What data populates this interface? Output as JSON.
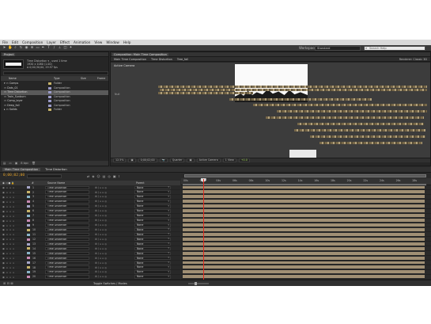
{
  "menu": [
    "File",
    "Edit",
    "Composition",
    "Layer",
    "Effect",
    "Animation",
    "View",
    "Window",
    "Help"
  ],
  "toolbar": {
    "workspace_label": "Workspace:",
    "workspace_value": "Standard",
    "search_placeholder": "Search Help"
  },
  "project": {
    "tab": "Project",
    "info": [
      "Time Distortion ▾ , used 1 time",
      "1920 x 1080 (1.00)",
      "Δ 0;00;30;00, 29.97 fps"
    ],
    "columns": {
      "name": "Name",
      "type": "Type",
      "size": "Size",
      "fr": "Frame"
    },
    "items": [
      {
        "name": "▾ ▭ Comps",
        "type": "Folder",
        "color": "#c8b46a",
        "selected": false
      },
      {
        "name": "  ▭ Dots_01",
        "type": "Composition",
        "color": "#9a9ac8",
        "selected": false
      },
      {
        "name": "  ▭ Time Distortion",
        "type": "Composition",
        "color": "#9a9ac8",
        "selected": true
      },
      {
        "name": "  ▭ Train_Sunburn",
        "type": "Composition",
        "color": "#9a9ac8",
        "selected": false
      },
      {
        "name": "  ▭ Comp_layer",
        "type": "Composition",
        "color": "#9a9ac8",
        "selected": false
      },
      {
        "name": "  ▭ Deep_fall",
        "type": "Composition",
        "color": "#9a9ac8",
        "selected": false
      },
      {
        "name": "▸ ▭ Solids",
        "type": "Folder",
        "color": "#c8b46a",
        "selected": false
      }
    ],
    "bpc": "8 bpc"
  },
  "comp": {
    "tab": "Composition: Main Time Composition",
    "crumbs": [
      "Main Time Composition",
      "Time Distortion",
      "Tree_fall"
    ],
    "renderer": "Renderer: Classic 3D",
    "camera": "Active Camera",
    "null_label": "Null",
    "viewer_bar": [
      "12.5%",
      "▣",
      "0;00;02;00",
      "📷",
      "Quarter",
      "▣",
      "Active Camera",
      "1 View",
      "+0.0"
    ]
  },
  "timeline": {
    "tabs": [
      "Main Time Composition",
      "Time Distortion"
    ],
    "timecode": "0;00;02;00",
    "columns": {
      "source": "Source Name",
      "parent": "Parent"
    },
    "layers": [
      {
        "num": "1",
        "name": "Time Distortion",
        "parent": "None"
      },
      {
        "num": "2",
        "name": "Time Distortion",
        "parent": "None"
      },
      {
        "num": "3",
        "name": "Time Distortion",
        "parent": "None"
      },
      {
        "num": "4",
        "name": "Time Distortion",
        "parent": "None"
      },
      {
        "num": "5",
        "name": "Time Distortion",
        "parent": "None"
      },
      {
        "num": "6",
        "name": "Time Distortion",
        "parent": "None"
      },
      {
        "num": "7",
        "name": "Time Distortion",
        "parent": "None"
      },
      {
        "num": "8",
        "name": "Time Distortion",
        "parent": "None"
      },
      {
        "num": "9",
        "name": "Time Distortion",
        "parent": "None"
      },
      {
        "num": "10",
        "name": "Time Distortion",
        "parent": "None"
      },
      {
        "num": "11",
        "name": "Time Distortion",
        "parent": "None"
      },
      {
        "num": "12",
        "name": "Time Distortion",
        "parent": "None"
      },
      {
        "num": "13",
        "name": "Time Distortion",
        "parent": "None"
      },
      {
        "num": "14",
        "name": "Time Distortion",
        "parent": "None"
      },
      {
        "num": "15",
        "name": "Time Distortion",
        "parent": "None"
      },
      {
        "num": "16",
        "name": "Time Distortion",
        "parent": "None"
      },
      {
        "num": "17",
        "name": "Time Distortion",
        "parent": "None"
      },
      {
        "num": "18",
        "name": "Time Distortion",
        "parent": "None"
      },
      {
        "num": "19",
        "name": "Time Distortion",
        "parent": "None"
      },
      {
        "num": "20",
        "name": "Time Distortion",
        "parent": "None"
      }
    ],
    "ruler": [
      "00s",
      "02s",
      "04s",
      "06s",
      "08s",
      "10s",
      "12s",
      "14s",
      "16s",
      "18s",
      "20s",
      "22s",
      "24s",
      "26s",
      "28s"
    ],
    "playhead_seconds": 2,
    "toggle_label": "Toggle Switches / Modes"
  }
}
